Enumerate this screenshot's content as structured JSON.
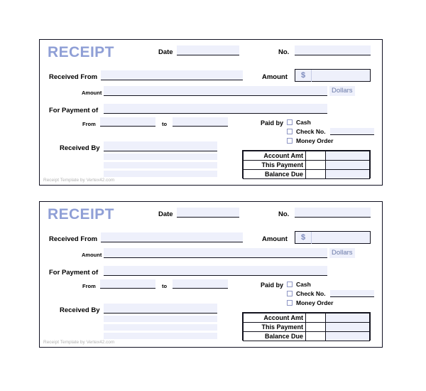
{
  "document": {
    "background_color": "#ffffff",
    "title_color": "#8f9fd6",
    "field_fill_color": "#eef0fb",
    "border_color": "#14141f",
    "footer_color": "#b3b3b3"
  },
  "receipt": {
    "title": "RECEIPT",
    "labels": {
      "date": "Date",
      "number": "No.",
      "received_from": "Received From",
      "amount": "Amount",
      "amount_small": "Amount",
      "dollars": "Dollars",
      "for_payment_of": "For Payment of",
      "from": "From",
      "to": "to",
      "received_by": "Received By",
      "paid_by": "Paid by"
    },
    "currency_symbol": "$",
    "values": {
      "date": "",
      "number": "",
      "received_from": "",
      "amount": "",
      "amount_words": "",
      "for_payment_of": "",
      "period_from": "",
      "period_to": "",
      "received_by": "",
      "check_no": ""
    },
    "payment_methods": [
      {
        "label": "Cash",
        "checked": false,
        "has_field": false
      },
      {
        "label": "Check No.",
        "checked": false,
        "has_field": true
      },
      {
        "label": "Money Order",
        "checked": false,
        "has_field": false
      }
    ],
    "totals": [
      {
        "label": "Account Amt",
        "value": ""
      },
      {
        "label": "This Payment",
        "value": ""
      },
      {
        "label": "Balance Due",
        "value": ""
      }
    ],
    "footer": "Receipt Template by Vertex42.com"
  },
  "copies": [
    {
      "index": 1
    },
    {
      "index": 2
    }
  ]
}
